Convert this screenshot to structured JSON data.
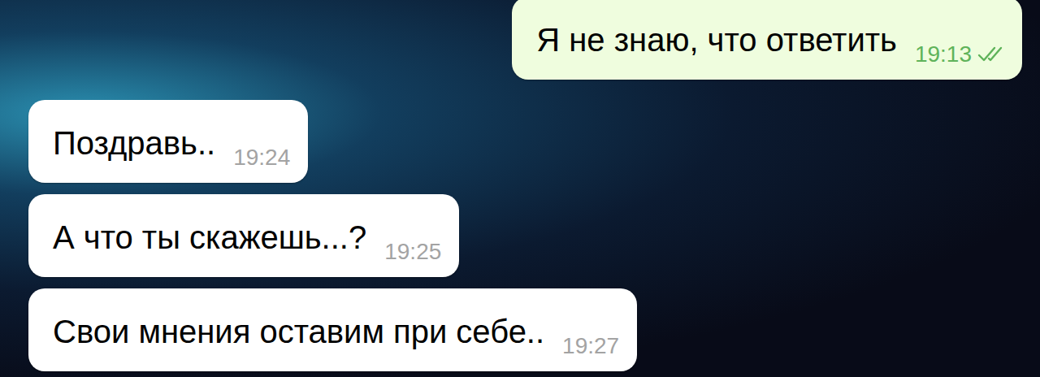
{
  "messages": [
    {
      "kind": "outgoing",
      "text": "Я не знаю, что ответить",
      "time": "19:13",
      "read": true
    },
    {
      "kind": "incoming",
      "text": "Поздравь..",
      "time": "19:24"
    },
    {
      "kind": "incoming",
      "text": "А что ты скажешь...?",
      "time": "19:25"
    },
    {
      "kind": "incoming",
      "text": "Свои мнения оставим при себе..",
      "time": "19:27"
    }
  ]
}
